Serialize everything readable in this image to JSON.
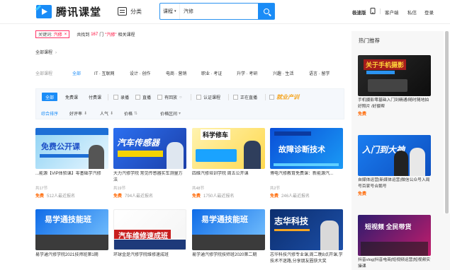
{
  "header": {
    "logo_text": "腾讯课堂",
    "category_label": "分类",
    "search_scope": "课程",
    "search_value": "汽修",
    "nav": [
      "极速版",
      "客户端",
      "私信",
      "登录"
    ],
    "brand_color": "#1a8cf7"
  },
  "breadcrumb": {
    "keyword_label": "关键词:",
    "keyword": "汽修",
    "close": "×",
    "result_prefix": "共找到",
    "count": "167",
    "result_mid": "门",
    "result_kw": "\"汽修\"",
    "result_suffix": "相关课程"
  },
  "all_courses_link": "全部课程",
  "category_tabs": [
    "全部课程",
    "全部",
    "IT · 互联网",
    "设计 · 创作",
    "电商 · 营销",
    "职业 · 考证",
    "升学 · 考研",
    "兴趣 · 生活",
    "语言 · 留学"
  ],
  "filters": {
    "row1": [
      "全部",
      "免费课",
      "付费课"
    ],
    "checks": [
      "录播",
      "直播",
      "有回放",
      "认证课程",
      "正在直播"
    ],
    "promo": "就业产training",
    "row2_default": "综合排序",
    "row2": [
      "好评率",
      "人气",
      "价格",
      "价格区间"
    ]
  },
  "cards": [
    {
      "banner": "免费公开课",
      "title": "...能源【VIP体验课】零基础学汽修",
      "meta": "共17节",
      "price": "免费",
      "enroll": "512人最近报名"
    },
    {
      "banner": "汽车传感器",
      "title": "大力汽修学院 常见传感器实车测量方法",
      "meta": "共19节",
      "price": "免费",
      "enroll": "794人最近报名"
    },
    {
      "banner": "科学修车",
      "title": "四维汽修培训学院 周五公开课",
      "meta": "共48节",
      "price": "免费",
      "enroll": "1750人最近报名"
    },
    {
      "banner": "故障诊断技术",
      "title": "博电汽修教育免费课：新能源汽...",
      "meta": "共2节",
      "price": "免费",
      "enroll": "246人最近报名"
    },
    {
      "banner": "易学通技能班",
      "title": "易学通汽修学院2021技师班第1期",
      "meta": "",
      "price": "",
      "enroll": ""
    },
    {
      "banner": "汽车维修速成班",
      "title": "环球金是汽修学院维修速成班",
      "meta": "",
      "price": "",
      "enroll": ""
    },
    {
      "banner": "易学通技能班",
      "title": "易学通汽修学院技师班2020第二期",
      "meta": "",
      "price": "",
      "enroll": ""
    },
    {
      "banner": "志华科技",
      "title": "志华科技汽修专业课,周二晚8点开课,学技术不迷路,分享朋友圈获大奖",
      "meta": "",
      "price": "",
      "enroll": ""
    }
  ],
  "sidebar": {
    "title": "热门推荐",
    "items": [
      {
        "banner": "关于手机摄影",
        "title": "手机摄影零基础入门到精通/随时随地拍好照片 /好摄帮",
        "price": "免费"
      },
      {
        "banner": "入门到大神",
        "title": "自媒体运营|新媒体运营|微信公众号入局号百家号合鹅号",
        "price": "免费"
      },
      {
        "banner": "短视频 全民带货",
        "title": "抖音vlog|抖音电商|短视频运营|短视频实操课",
        "price": ""
      }
    ]
  }
}
